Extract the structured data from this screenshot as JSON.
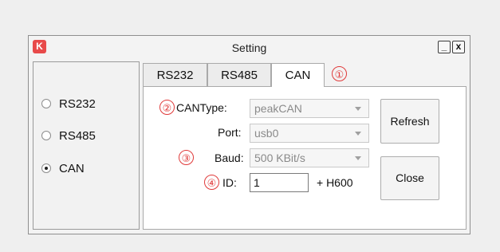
{
  "window": {
    "title": "Setting",
    "app_icon_glyph": "K",
    "minimize_glyph": "_",
    "close_glyph": "x"
  },
  "interface_options": [
    {
      "label": "RS232",
      "checked": false
    },
    {
      "label": "RS485",
      "checked": false
    },
    {
      "label": "CAN",
      "checked": true
    }
  ],
  "tabs": [
    {
      "label": "RS232",
      "active": false
    },
    {
      "label": "RS485",
      "active": false
    },
    {
      "label": "CAN",
      "active": true
    }
  ],
  "annotations": [
    "①",
    "②",
    "③",
    "④"
  ],
  "can_settings": {
    "cantype_label": "CANType:",
    "cantype_value": "peakCAN",
    "port_label": "Port:",
    "port_value": "usb0",
    "baud_label": "Baud:",
    "baud_value": "500 KBit/s",
    "id_label": "ID:",
    "id_value": "1",
    "id_suffix": "+ H600"
  },
  "buttons": {
    "refresh": "Refresh",
    "close": "Close"
  },
  "colors": {
    "annotation": "#e03a3a",
    "app_icon": "#e84a4a"
  }
}
